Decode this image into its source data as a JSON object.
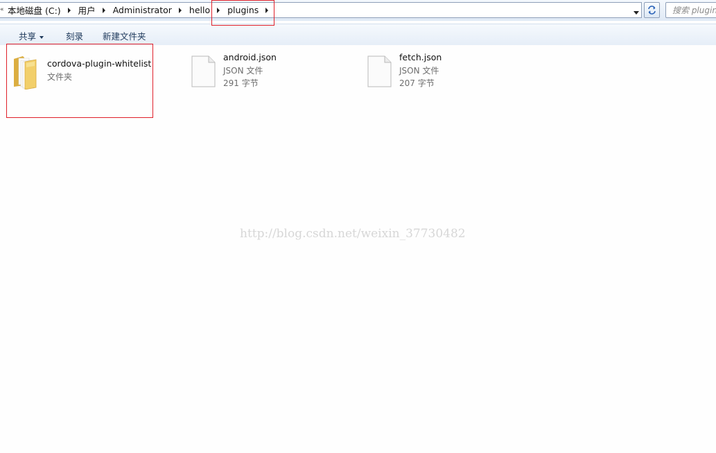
{
  "address_bar": {
    "breadcrumbs": [
      "本地磁盘 (C:)",
      "用户",
      "Administrator",
      "hello",
      "plugins"
    ],
    "search_placeholder": "搜索 plugins"
  },
  "toolbar": {
    "share_label": "共享",
    "burn_label": "刻录",
    "new_folder_label": "新建文件夹"
  },
  "files": [
    {
      "name": "cordova-plugin-whitelist",
      "type": "文件夹",
      "size": "",
      "icon": "folder-icon"
    },
    {
      "name": "android.json",
      "type": "JSON 文件",
      "size": "291 字节",
      "icon": "document-icon"
    },
    {
      "name": "fetch.json",
      "type": "JSON 文件",
      "size": "207 字节",
      "icon": "document-icon"
    }
  ],
  "watermark": "http://blog.csdn.net/weixin_37730482",
  "colors": {
    "highlight": "#e0202a",
    "toolbar_text": "#1e395b",
    "folder": "#f2cf6a"
  }
}
